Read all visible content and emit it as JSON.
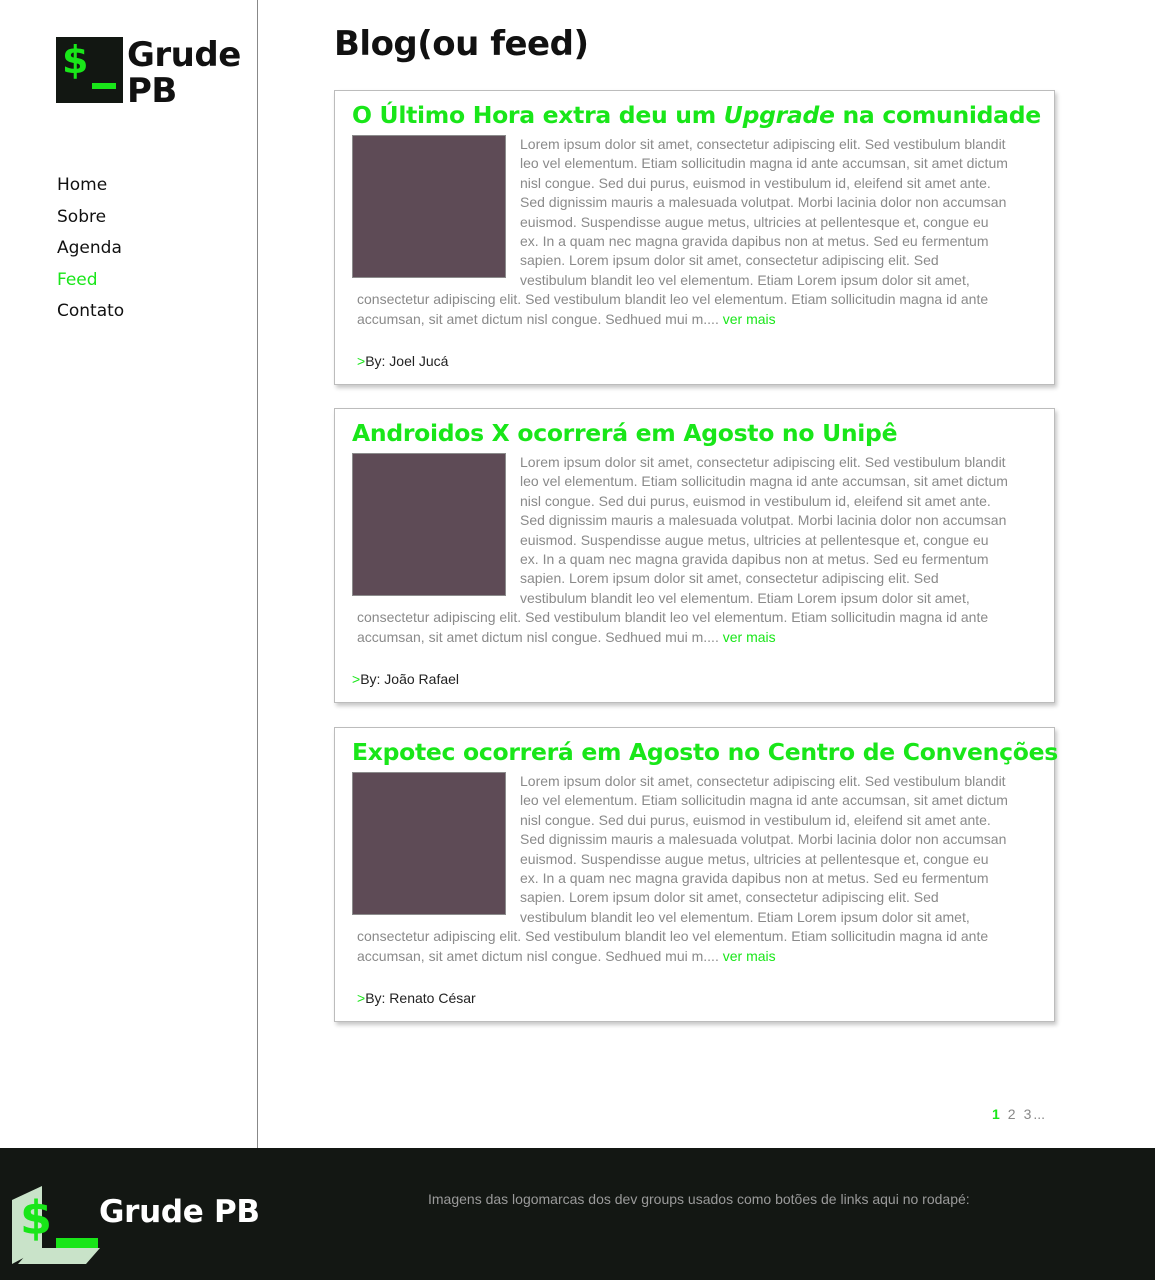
{
  "brand": {
    "logo_symbol": "$",
    "name_line1": "Grude",
    "name_line2": "PB",
    "accent_color": "#19e619",
    "dark_color": "#131713"
  },
  "nav": {
    "items": [
      {
        "label": "Home",
        "active": false
      },
      {
        "label": "Sobre",
        "active": false
      },
      {
        "label": "Agenda",
        "active": false
      },
      {
        "label": "Feed",
        "active": true
      },
      {
        "label": "Contato",
        "active": false
      }
    ]
  },
  "page": {
    "title": "Blog(ou feed)"
  },
  "posts": [
    {
      "title_before": "O Último Hora extra deu um ",
      "title_em": "Upgrade",
      "title_after": " na comunidade",
      "body": "Lorem ipsum dolor sit amet, consectetur adipiscing elit. Sed vestibulum blandit leo vel elementum. Etiam sollicitudin magna id ante accumsan, sit amet dictum nisl congue. Sed dui purus, euismod in vestibulum id, eleifend sit amet ante. Sed dignissim mauris a malesuada volutpat. Morbi lacinia dolor non accumsan euismod. Suspendisse augue metus, ultricies at pellentesque et, congue eu ex. In a quam nec magna gravida dapibus non at metus. Sed eu fermentum sapien. Lorem ipsum dolor sit amet, consectetur adipiscing elit. Sed vestibulum blandit leo vel elementum. Etiam Lorem ipsum dolor sit amet, consectetur adipiscing elit. Sed vestibulum blandit leo vel elementum. Etiam sollicitudin magna id ante accumsan, sit amet dictum nisl congue. Sedhued mui m.... ",
      "more_label": "ver mais",
      "byline_arrow": ">",
      "byline": "By: Joel Jucá"
    },
    {
      "title_before": "Androidos X ocorrerá em Agosto no Unipê",
      "title_em": "",
      "title_after": "",
      "body": "Lorem ipsum dolor sit amet, consectetur adipiscing elit. Sed vestibulum blandit leo vel elementum. Etiam sollicitudin magna id ante accumsan, sit amet dictum nisl congue. Sed dui purus, euismod in vestibulum id, eleifend sit amet ante. Sed dignissim mauris a malesuada volutpat. Morbi lacinia dolor non accumsan euismod. Suspendisse augue metus, ultricies at pellentesque et, congue eu ex. In a quam nec magna gravida dapibus non at metus. Sed eu fermentum sapien. Lorem ipsum dolor sit amet, consectetur adipiscing elit. Sed vestibulum blandit leo vel elementum. Etiam Lorem ipsum dolor sit amet, consectetur adipiscing elit. Sed vestibulum blandit leo vel elementum. Etiam sollicitudin magna id ante accumsan, sit amet dictum nisl congue. Sedhued mui m.... ",
      "more_label": "ver mais",
      "byline_arrow": ">",
      "byline": "By: João Rafael"
    },
    {
      "title_before": "Expotec ocorrerá em Agosto no Centro de Convenções",
      "title_em": "",
      "title_after": "",
      "body": "Lorem ipsum dolor sit amet, consectetur adipiscing elit. Sed vestibulum blandit leo vel elementum. Etiam sollicitudin magna id ante accumsan, sit amet dictum nisl congue. Sed dui purus, euismod in vestibulum id, eleifend sit amet ante. Sed dignissim mauris a malesuada volutpat. Morbi lacinia dolor non accumsan euismod. Suspendisse augue metus, ultricies at pellentesque et, congue eu ex. In a quam nec magna gravida dapibus non at metus. Sed eu fermentum sapien. Lorem ipsum dolor sit amet, consectetur adipiscing elit. Sed vestibulum blandit leo vel elementum. Etiam Lorem ipsum dolor sit amet, consectetur adipiscing elit. Sed vestibulum blandit leo vel elementum. Etiam sollicitudin magna id ante accumsan, sit amet dictum nisl congue. Sedhued mui m.... ",
      "more_label": "ver mais",
      "byline_arrow": ">",
      "byline": "By: Renato César"
    }
  ],
  "pagination": {
    "pages": [
      "1",
      "2",
      "3"
    ],
    "current": "1",
    "ellipsis": "..."
  },
  "footer": {
    "brand": "Grude PB",
    "note": "Imagens das logomarcas dos dev groups usados como botões de links aqui no rodapé:"
  }
}
